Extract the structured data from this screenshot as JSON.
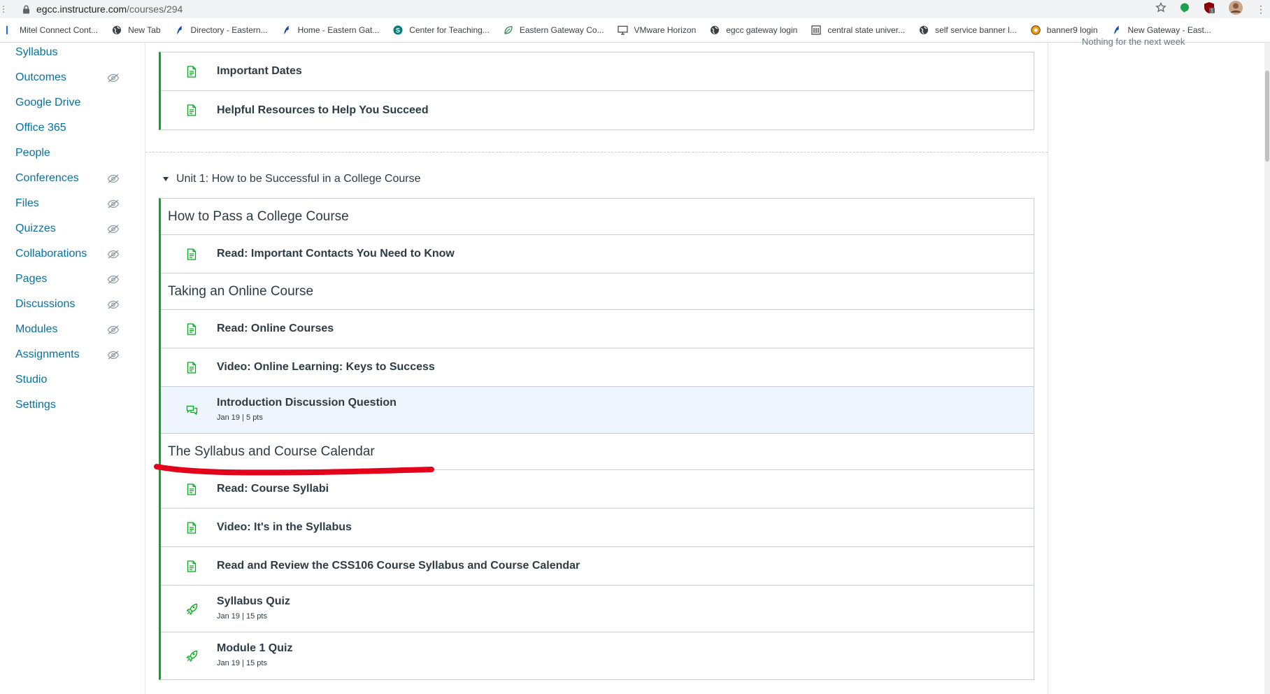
{
  "browser": {
    "url_host": "egcc.instructure.com",
    "url_path": "/courses/294",
    "bookmarks": [
      {
        "label": "Mitel Connect Cont...",
        "icon": "mitel-icon"
      },
      {
        "label": "New Tab",
        "icon": "globe-icon"
      },
      {
        "label": "Directory - Eastern...",
        "icon": "eagle-icon"
      },
      {
        "label": "Home - Eastern Gat...",
        "icon": "eagle-icon"
      },
      {
        "label": "Center for Teaching...",
        "icon": "sharepoint-icon"
      },
      {
        "label": "Eastern Gateway Co...",
        "icon": "leaf-icon"
      },
      {
        "label": "VMware Horizon",
        "icon": "monitor-icon"
      },
      {
        "label": "egcc gateway login",
        "icon": "globe-icon"
      },
      {
        "label": "central state univer...",
        "icon": "building-icon"
      },
      {
        "label": "self service banner l...",
        "icon": "globe-icon"
      },
      {
        "label": "banner9 login",
        "icon": "ellucian-icon"
      },
      {
        "label": "New Gateway - East...",
        "icon": "eagle-icon"
      }
    ]
  },
  "sidebar": {
    "items": [
      {
        "label": "Syllabus",
        "hidden": false
      },
      {
        "label": "Outcomes",
        "hidden": true
      },
      {
        "label": "Google Drive",
        "hidden": false
      },
      {
        "label": "Office 365",
        "hidden": false
      },
      {
        "label": "People",
        "hidden": false
      },
      {
        "label": "Conferences",
        "hidden": true
      },
      {
        "label": "Files",
        "hidden": true
      },
      {
        "label": "Quizzes",
        "hidden": true
      },
      {
        "label": "Collaborations",
        "hidden": true
      },
      {
        "label": "Pages",
        "hidden": true
      },
      {
        "label": "Discussions",
        "hidden": true
      },
      {
        "label": "Modules",
        "hidden": true
      },
      {
        "label": "Assignments",
        "hidden": true
      },
      {
        "label": "Studio",
        "hidden": false
      },
      {
        "label": "Settings",
        "hidden": false
      }
    ]
  },
  "right_panel": {
    "todo_text": "Nothing for the next week"
  },
  "prev_module": {
    "items": [
      {
        "title": "Important Dates",
        "icon": "page-icon"
      },
      {
        "title": "Helpful Resources to Help You Succeed",
        "icon": "page-icon"
      }
    ]
  },
  "unit1": {
    "title": "Unit 1: How to be Successful in a College Course",
    "h1": "How to Pass a College Course",
    "i1": "Read: Important Contacts You Need to Know",
    "h2": "Taking an Online Course",
    "i2": "Read: Online Courses",
    "i3": "Video: Online Learning: Keys to Success",
    "i4": "Introduction Discussion Question",
    "i4_date": "Jan 19",
    "i4_pts": "5 pts",
    "h3": "The Syllabus and Course Calendar",
    "i5": "Read: Course Syllabi",
    "i6": "Video: It's in the Syllabus",
    "i7": "Read and Review the CSS106 Course Syllabus and Course Calendar",
    "i8": "Syllabus Quiz",
    "i8_date": "Jan 19",
    "i8_pts": "15 pts",
    "i9": "Module 1 Quiz",
    "i9_date": "Jan 19",
    "i9_pts": "15 pts"
  },
  "meta_separator": "|",
  "colors": {
    "link": "#0770a3",
    "module_accent": "#00ac18",
    "highlight": "#eef5fc",
    "annotation": "#e3001b"
  }
}
